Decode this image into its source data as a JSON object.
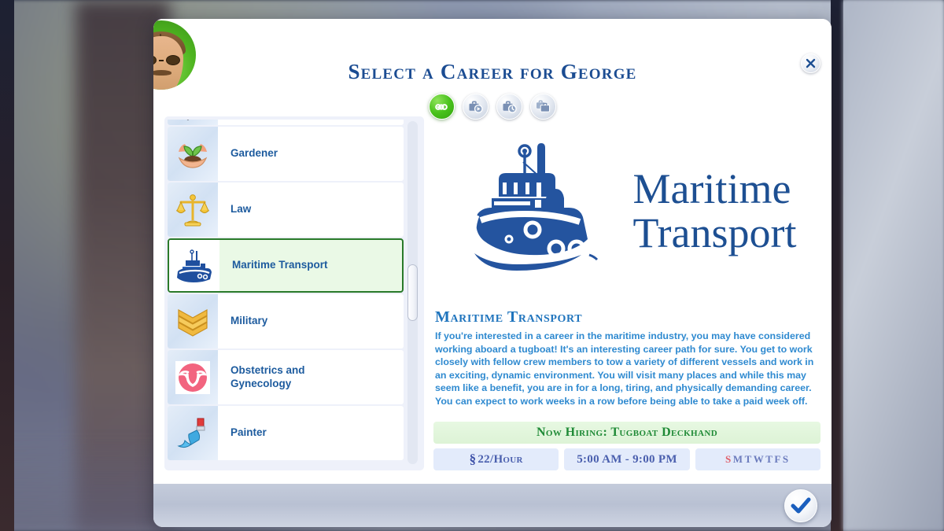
{
  "dialog": {
    "title": "Select a Career for George",
    "close_label": "×"
  },
  "avatar": {
    "name": "sim-portrait-george"
  },
  "filters": [
    {
      "id": "all",
      "icon": "infinity-icon",
      "label": "All Careers",
      "active": true
    },
    {
      "id": "active",
      "icon": "briefcase-play-icon",
      "label": "Active Careers",
      "active": false
    },
    {
      "id": "parttime",
      "icon": "briefcase-clock-icon",
      "label": "Part Time Careers",
      "active": false
    },
    {
      "id": "multiple",
      "icon": "briefcase-stack-icon",
      "label": "Odd Jobs",
      "active": false
    }
  ],
  "career_list": [
    {
      "label": "",
      "icon": "freelancer-icon",
      "selected": false,
      "partial": true
    },
    {
      "label": "Gardener",
      "icon": "seedling-icon",
      "selected": false
    },
    {
      "label": "Law",
      "icon": "scales-icon",
      "selected": false
    },
    {
      "label": "Maritime Transport",
      "icon": "tugboat-icon",
      "selected": true
    },
    {
      "label": "Military",
      "icon": "chevrons-icon",
      "selected": false
    },
    {
      "label": "Obstetrics and\nGynecology",
      "icon": "uterus-icon",
      "selected": false
    },
    {
      "label": "Painter",
      "icon": "paintbrush-icon",
      "selected": false
    }
  ],
  "detail": {
    "hero_title": "Maritime\nTransport",
    "hero_art": "tugboat-logo",
    "heading": "Maritime Transport",
    "description": "If you're interested in a career in the maritime industry, you may have considered working aboard a tugboat! It's an interesting career path for sure. You get to work closely with fellow crew members to tow a variety of different vessels and work in an exciting, dynamic environment. You will visit many places and while this may seem like a benefit, you are in for a long, tiring, and physically demanding career. You can expect to work weeks in a row before being able to take a paid week off.",
    "hiring_banner": "Now Hiring: Tugboat Deckhand",
    "stats": {
      "wage_symbol": "§",
      "wage": "22/Hour",
      "hours": "5:00 AM - 9:00 PM",
      "days": [
        {
          "letter": "S",
          "off": true
        },
        {
          "letter": "M",
          "off": false
        },
        {
          "letter": "T",
          "off": false
        },
        {
          "letter": "W",
          "off": false
        },
        {
          "letter": "T",
          "off": false
        },
        {
          "letter": "F",
          "off": false
        },
        {
          "letter": "S",
          "off": false
        }
      ]
    }
  },
  "footer": {
    "confirm_label": "Confirm"
  },
  "colors": {
    "title_blue": "#1b4c92",
    "label_blue": "#1d5b9e",
    "desc_blue": "#2f8ad0",
    "heading_blue": "#1f74bd",
    "hiring_green": "#1f8a36",
    "select_green": "#2a7a2a",
    "chip_bg": "#e3ebfb",
    "day_off_red": "#e0606c"
  }
}
